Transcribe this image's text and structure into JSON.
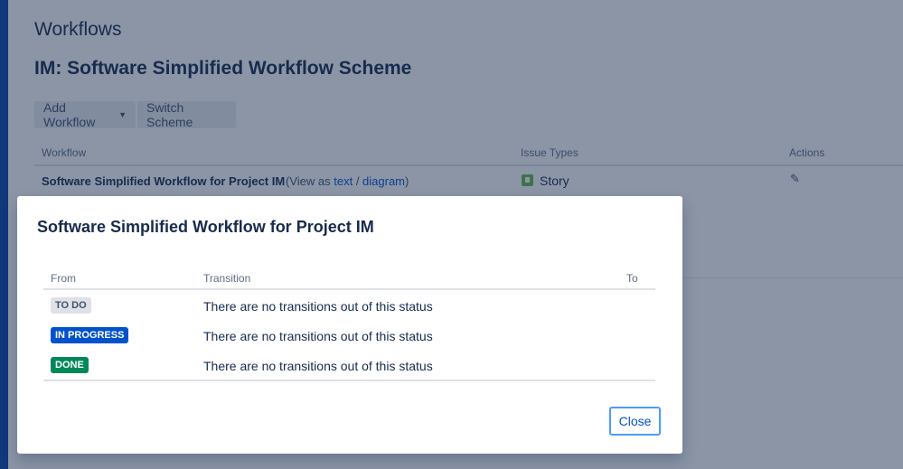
{
  "page": {
    "title": "Workflows",
    "scheme_title": "IM: Software Simplified Workflow Scheme",
    "add_workflow_label": "Add Workflow",
    "switch_scheme_label": "Switch Scheme"
  },
  "table": {
    "headers": {
      "workflow": "Workflow",
      "issue_types": "Issue Types",
      "actions": "Actions"
    },
    "row": {
      "name": "Software Simplified Workflow for Project IM",
      "view_prefix": "(View as ",
      "text_link": "text",
      "separator": " / ",
      "diagram_link": "diagram",
      "view_suffix": ")",
      "issue_type": "Story"
    }
  },
  "dialog": {
    "title": "Software Simplified Workflow for Project IM",
    "headers": {
      "from": "From",
      "transition": "Transition",
      "to": "To"
    },
    "rows": [
      {
        "status": "TO DO",
        "transition": "There are no transitions out of this status"
      },
      {
        "status": "IN PROGRESS",
        "transition": "There are no transitions out of this status"
      },
      {
        "status": "DONE",
        "transition": "There are no transitions out of this status"
      }
    ],
    "close_label": "Close"
  },
  "icons": {
    "add_chevron": "chevron-down-icon",
    "story": "story-icon",
    "edit": "pencil-icon"
  },
  "colors": {
    "todo": "#dfe1e6",
    "in_progress": "#0052cc",
    "done": "#00875a",
    "link": "#0052cc",
    "story": "#65ba43"
  }
}
